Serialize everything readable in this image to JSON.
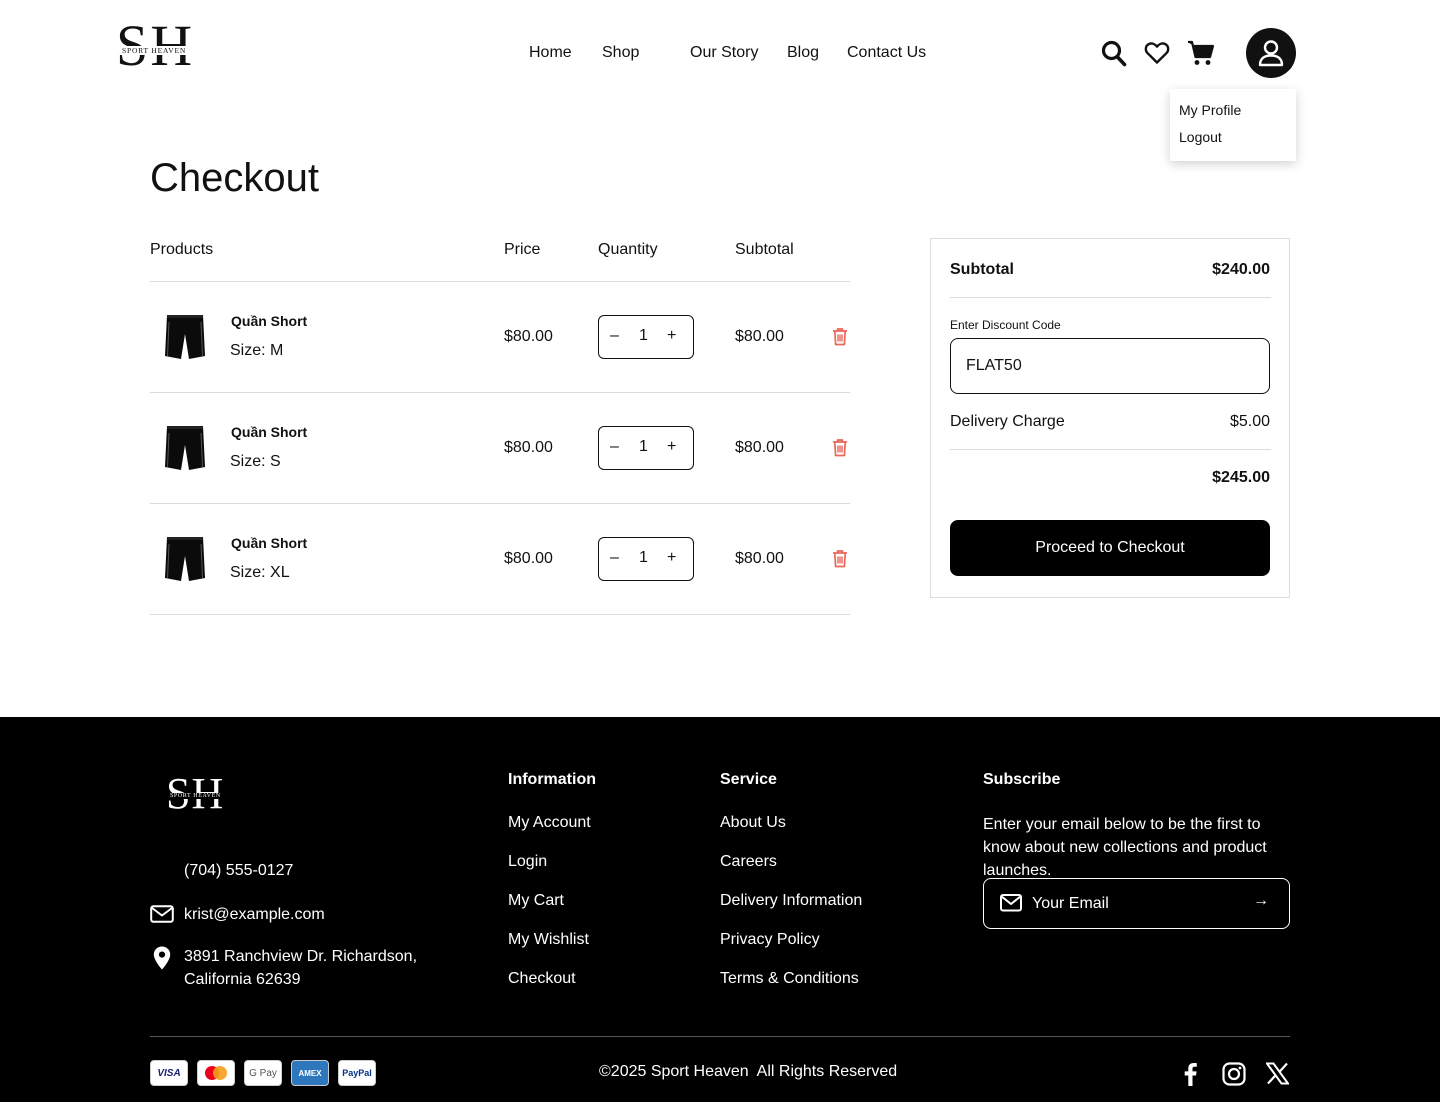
{
  "brand": {
    "logo_letters": "SH",
    "logo_name": "SPORT HEAVEN"
  },
  "nav": {
    "home": "Home",
    "shop": "Shop",
    "story": "Our Story",
    "blog": "Blog",
    "contact": "Contact Us"
  },
  "user_menu": {
    "profile": "My Profile",
    "logout": "Logout"
  },
  "page": {
    "title": "Checkout"
  },
  "table": {
    "headers": {
      "products": "Products",
      "price": "Price",
      "quantity": "Quantity",
      "subtotal": "Subtotal"
    },
    "rows": [
      {
        "name": "Quần Short",
        "size": "Size: M",
        "price": "$80.00",
        "qty": "1",
        "subtotal": "$80.00"
      },
      {
        "name": "Quần Short",
        "size": "Size: S",
        "price": "$80.00",
        "qty": "1",
        "subtotal": "$80.00"
      },
      {
        "name": "Quần Short",
        "size": "Size: XL",
        "price": "$80.00",
        "qty": "1",
        "subtotal": "$80.00"
      }
    ],
    "minus": "–",
    "plus": "+"
  },
  "summary": {
    "subtotal_label": "Subtotal",
    "subtotal_value": "$240.00",
    "discount_label": "Enter Discount Code",
    "discount_value": "FLAT50",
    "delivery_label": "Delivery Charge",
    "delivery_value": "$5.00",
    "total_value": "$245.00",
    "checkout_button": "Proceed to Checkout"
  },
  "footer": {
    "phone": "(704) 555-0127",
    "email": "krist@example.com",
    "address_line1": "3891 Ranchview Dr. Richardson,",
    "address_line2": "California 62639",
    "information": {
      "heading": "Information",
      "links": [
        "My Account",
        "Login",
        "My Cart",
        "My Wishlist",
        "Checkout"
      ]
    },
    "service": {
      "heading": "Service",
      "links": [
        "About Us",
        "Careers",
        "Delivery Information",
        "Privacy Policy",
        "Terms & Conditions"
      ]
    },
    "subscribe": {
      "heading": "Subscribe",
      "text": "Enter your email below to be the first to know about new collections and product launches.",
      "placeholder": "Your Email",
      "arrow": "→"
    },
    "payment_cards": [
      "VISA",
      "mastercard",
      "G Pay",
      "AMEX",
      "PayPal"
    ],
    "copyright": "©2025 Sport Heaven  All Rights Reserved",
    "socials": [
      "facebook-icon",
      "instagram-icon",
      "x-icon"
    ]
  },
  "colors": {
    "accent": "#000000",
    "trash": "#e8665a",
    "border": "#dcdcdc"
  }
}
